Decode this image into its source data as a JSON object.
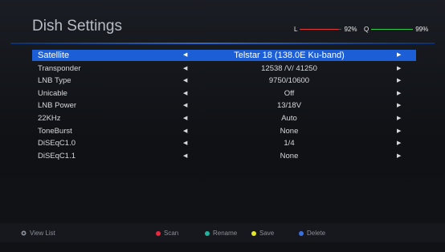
{
  "header": {
    "title": "Dish Settings"
  },
  "signal": {
    "l_label": "L",
    "l_value": "92%",
    "l_level": 0.92,
    "l_color": "#e23a3a",
    "q_label": "Q",
    "q_value": "99%",
    "q_level": 0.99,
    "q_color": "#36c94a"
  },
  "menu": {
    "rows": [
      {
        "label": "Satellite",
        "value": "Telstar 18 (138.0E Ku-band)",
        "selected": true
      },
      {
        "label": "Transponder",
        "value": "12538 /V/ 41250"
      },
      {
        "label": "LNB Type",
        "value": "9750/10600"
      },
      {
        "label": "Unicable",
        "value": "Off"
      },
      {
        "label": "LNB Power",
        "value": "13/18V"
      },
      {
        "label": "22KHz",
        "value": "Auto"
      },
      {
        "label": "ToneBurst",
        "value": "None"
      },
      {
        "label": "DiSEqC1.0",
        "value": "1/4"
      },
      {
        "label": "DiSEqC1.1",
        "value": "None"
      }
    ]
  },
  "footer": {
    "view_list": "View List",
    "scan": "Scan",
    "rename": "Rename",
    "save": "Save",
    "delete": "Delete",
    "colors": {
      "scan": "#e8283c",
      "rename": "#22b3a0",
      "save": "#e6e62a",
      "delete": "#3a6fe0"
    }
  }
}
